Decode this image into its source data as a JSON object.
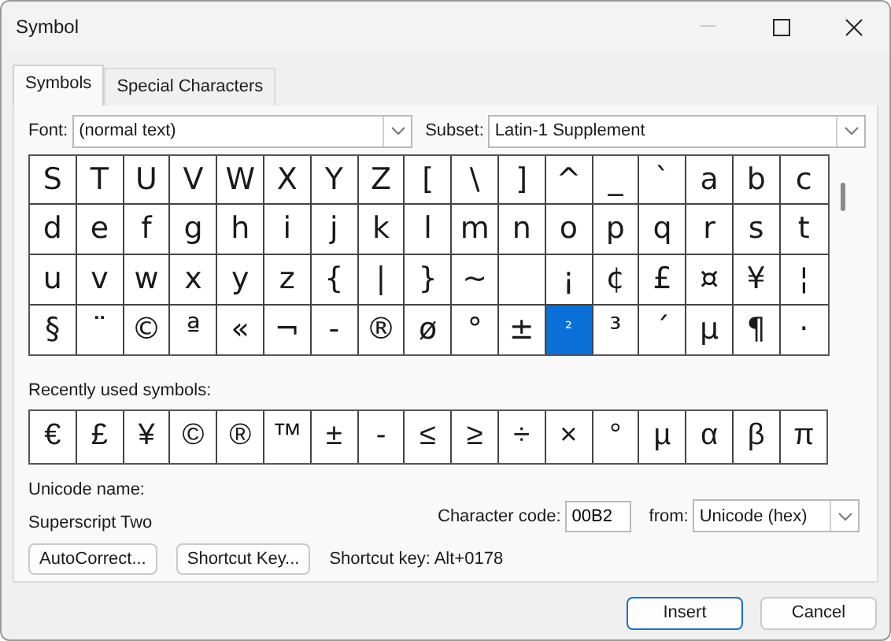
{
  "window": {
    "title": "Symbol"
  },
  "tabs": [
    {
      "label": "Symbols",
      "selected": true
    },
    {
      "label": "Special Characters",
      "selected": false
    }
  ],
  "font": {
    "label": "Font:",
    "value": "(normal text)"
  },
  "subset": {
    "label": "Subset:",
    "value": "Latin-1 Supplement"
  },
  "symbol_grid": [
    [
      {
        "char": "S",
        "selected": false
      },
      {
        "char": "T",
        "selected": false
      },
      {
        "char": "U",
        "selected": false
      },
      {
        "char": "V",
        "selected": false
      },
      {
        "char": "W",
        "selected": false
      },
      {
        "char": "X",
        "selected": false
      },
      {
        "char": "Y",
        "selected": false
      },
      {
        "char": "Z",
        "selected": false
      },
      {
        "char": "[",
        "selected": false
      },
      {
        "char": "\\",
        "selected": false
      },
      {
        "char": "]",
        "selected": false
      },
      {
        "char": "^",
        "selected": false
      },
      {
        "char": "_",
        "selected": false
      },
      {
        "char": "`",
        "selected": false
      },
      {
        "char": "a",
        "selected": false
      },
      {
        "char": "b",
        "selected": false
      },
      {
        "char": "c",
        "selected": false
      }
    ],
    [
      {
        "char": "d",
        "selected": false
      },
      {
        "char": "e",
        "selected": false
      },
      {
        "char": "f",
        "selected": false
      },
      {
        "char": "g",
        "selected": false
      },
      {
        "char": "h",
        "selected": false
      },
      {
        "char": "i",
        "selected": false
      },
      {
        "char": "j",
        "selected": false
      },
      {
        "char": "k",
        "selected": false
      },
      {
        "char": "l",
        "selected": false
      },
      {
        "char": "m",
        "selected": false
      },
      {
        "char": "n",
        "selected": false
      },
      {
        "char": "o",
        "selected": false
      },
      {
        "char": "p",
        "selected": false
      },
      {
        "char": "q",
        "selected": false
      },
      {
        "char": "r",
        "selected": false
      },
      {
        "char": "s",
        "selected": false
      },
      {
        "char": "t",
        "selected": false
      }
    ],
    [
      {
        "char": "u",
        "selected": false
      },
      {
        "char": "v",
        "selected": false
      },
      {
        "char": "w",
        "selected": false
      },
      {
        "char": "x",
        "selected": false
      },
      {
        "char": "y",
        "selected": false
      },
      {
        "char": "z",
        "selected": false
      },
      {
        "char": "{",
        "selected": false
      },
      {
        "char": "|",
        "selected": false
      },
      {
        "char": "}",
        "selected": false
      },
      {
        "char": "~",
        "selected": false
      },
      {
        "selected": false
      },
      {
        "char": "¡",
        "selected": false
      },
      {
        "char": "¢",
        "selected": false
      },
      {
        "char": "£",
        "selected": false
      },
      {
        "char": "¤",
        "selected": false
      },
      {
        "char": "¥",
        "selected": false
      },
      {
        "char": "¦",
        "selected": false
      }
    ],
    [
      {
        "char": "§",
        "selected": false
      },
      {
        "char": "¨",
        "selected": false
      },
      {
        "char": "©",
        "selected": false
      },
      {
        "char": "ª",
        "selected": false
      },
      {
        "char": "«",
        "selected": false
      },
      {
        "char": "¬",
        "selected": false
      },
      {
        "char": "-",
        "selected": false
      },
      {
        "char": "®",
        "selected": false
      },
      {
        "char": "ø",
        "selected": false
      },
      {
        "char": "°",
        "selected": false
      },
      {
        "char": "±",
        "selected": false
      },
      {
        "char": "²",
        "selected": true
      },
      {
        "char": "³",
        "selected": false
      },
      {
        "char": "´",
        "selected": false
      },
      {
        "char": "µ",
        "selected": false
      },
      {
        "char": "¶",
        "selected": false
      },
      {
        "char": "·",
        "selected": false
      }
    ]
  ],
  "recent": {
    "label": "Recently used symbols:",
    "symbols": [
      "€",
      "£",
      "¥",
      "©",
      "®",
      "™",
      "±",
      "-",
      "≤",
      "≥",
      "÷",
      "×",
      "°",
      "µ",
      "α",
      "β",
      "π"
    ]
  },
  "unicode_name": {
    "label": "Unicode name:",
    "value": "Superscript Two"
  },
  "character_code": {
    "label": "Character code:",
    "value": "00B2"
  },
  "from": {
    "label": "from:",
    "value": "Unicode (hex)"
  },
  "buttons": [
    {
      "label": "AutoCorrect..."
    },
    {
      "label": "Shortcut Key..."
    }
  ],
  "shortcut_key": "Shortcut key: Alt+0178",
  "footer_buttons": [
    {
      "label": "Insert",
      "default": true
    },
    {
      "label": "Cancel",
      "default": false
    }
  ]
}
